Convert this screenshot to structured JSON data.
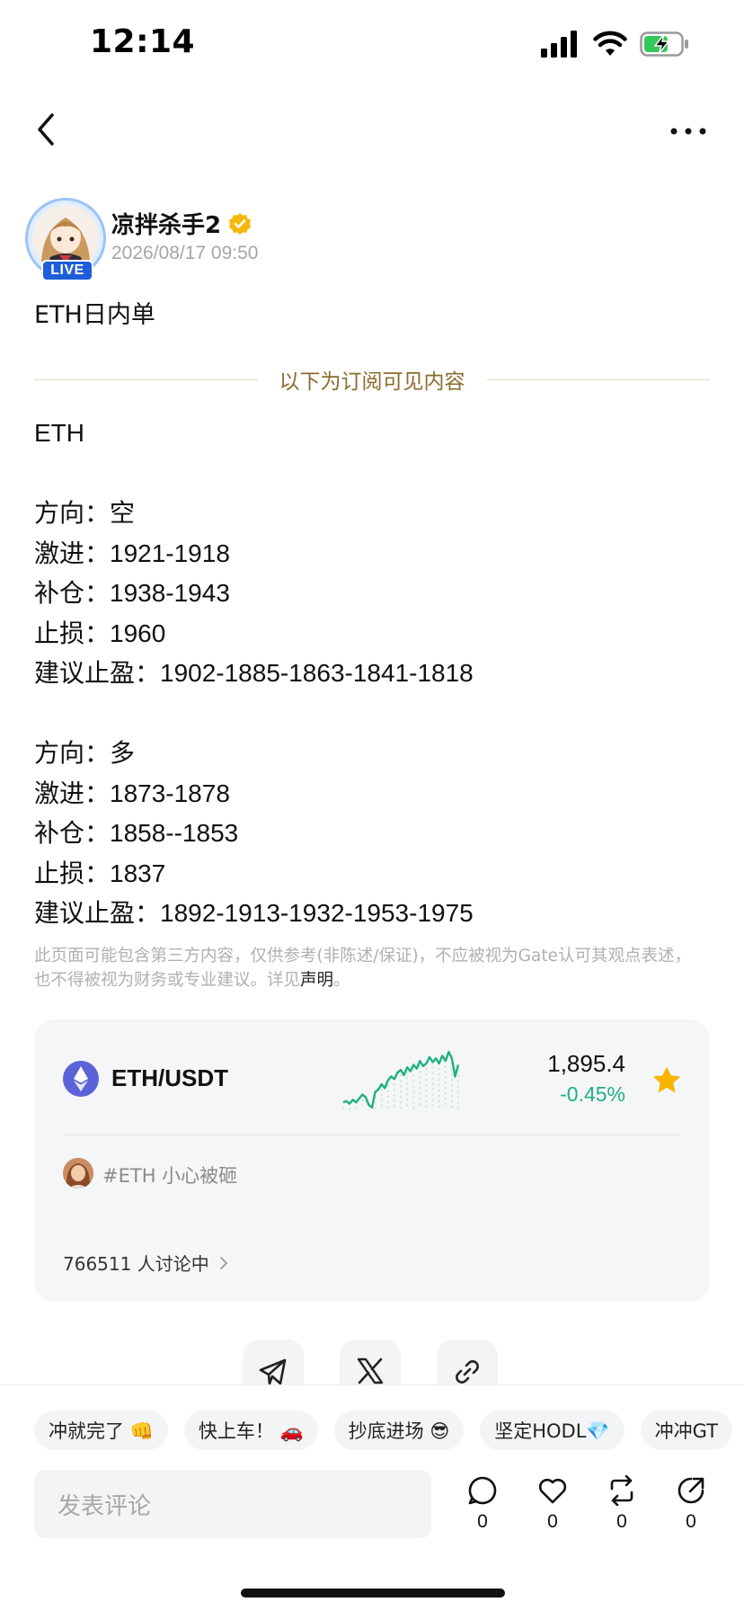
{
  "status_bar": {
    "time": "12:14"
  },
  "author": {
    "name": "凉拌杀手2",
    "live_label": "LIVE",
    "post_time": "2026/08/17 09:50"
  },
  "post": {
    "title": "ETH日内单",
    "subscription_divider": "以下为订阅可见内容",
    "lines": [
      "ETH",
      "",
      "方向：空",
      "激进：1921-1918",
      "补仓：1938-1943",
      "止损：1960",
      "建议止盈：1902-1885-1863-1841-1818",
      "",
      "方向：多",
      "激进：1873-1878",
      "补仓：1858--1853",
      "止损：1837",
      "建议止盈：1892-1913-1932-1953-1975"
    ],
    "disclaimer": "此页面可能包含第三方内容，仅供参考(非陈述/保证)，不应被视为Gate认可其观点表述，也不得被视为财务或专业建议。详见",
    "disclaimer_link": "声明",
    "disclaimer_end": "。"
  },
  "market_card": {
    "pair": "ETH/USDT",
    "price": "1,895.4",
    "change": "-0.45%",
    "change_color": "#1fb07f",
    "favorited": true,
    "sparkline": [
      6,
      7,
      5,
      8,
      6,
      9,
      12,
      10,
      4,
      2,
      14,
      16,
      20,
      17,
      23,
      26,
      24,
      29,
      31,
      27,
      33,
      30,
      35,
      32,
      38,
      34,
      36,
      41,
      37,
      40,
      36,
      42,
      38,
      45,
      40,
      26,
      35
    ],
    "topic": "#ETH 小心被砸",
    "discussion": "766511 人讨论中"
  },
  "share": [
    {
      "icon": "telegram-icon"
    },
    {
      "icon": "x-icon"
    },
    {
      "icon": "link-icon"
    }
  ],
  "bottom": {
    "chips": [
      "冲就完了 👊",
      "快上车！ 🚗",
      "抄底进场 😎",
      "坚定HODL💎",
      "冲冲GT"
    ],
    "comment_placeholder": "发表评论",
    "comments": "0",
    "likes": "0",
    "reposts": "0",
    "shares": "0"
  }
}
